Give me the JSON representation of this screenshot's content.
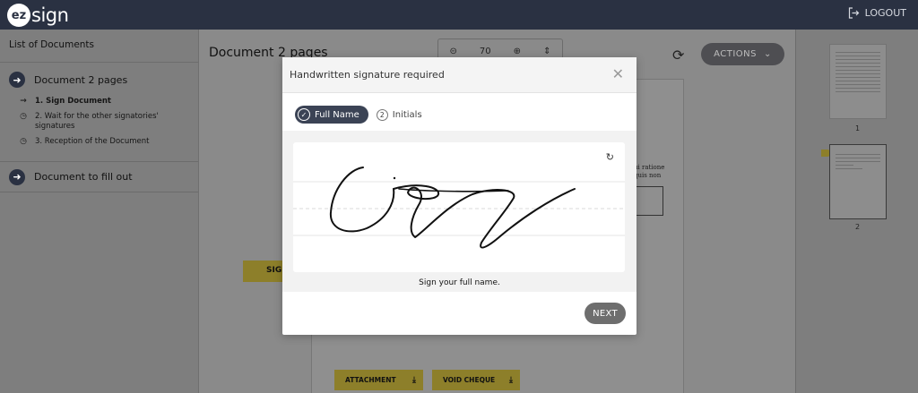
{
  "header": {
    "logo_mark": "ez",
    "logo_text": "sign",
    "logout_label": "LOGOUT"
  },
  "sidebar": {
    "title": "List of Documents",
    "current_doc": "Document 2 pages",
    "steps": [
      {
        "label": "1.  Sign Document",
        "icon": "arrow-right-icon"
      },
      {
        "label": "2.  Wait for the other signatories' signatures",
        "icon": "clock-icon"
      },
      {
        "label": "3.  Reception of the Document",
        "icon": "clock-icon"
      }
    ],
    "other_doc": "Document to fill out"
  },
  "viewer": {
    "title": "Document 2 pages",
    "zoom": "70",
    "actions_label": "ACTIONS",
    "sign_button": "SIGN",
    "page_text_1": "ui ratione",
    "page_text_2": "quis non",
    "attachment_label": "ATTACHMENT",
    "void_cheque_label": "VOID CHEQUE"
  },
  "thumbnails": {
    "page1": "1",
    "page2": "2"
  },
  "modal": {
    "title": "Handwritten signature required",
    "tab_full_name": "Full Name",
    "tab_initials_number": "2",
    "tab_initials": "Initials",
    "hint": "Sign your full name.",
    "next_label": "NEXT"
  },
  "colors": {
    "topbar": "#2a3142",
    "accent_yellow": "#e8d35a",
    "tab_active": "#3b4355",
    "next_button": "#6e6e6e"
  }
}
